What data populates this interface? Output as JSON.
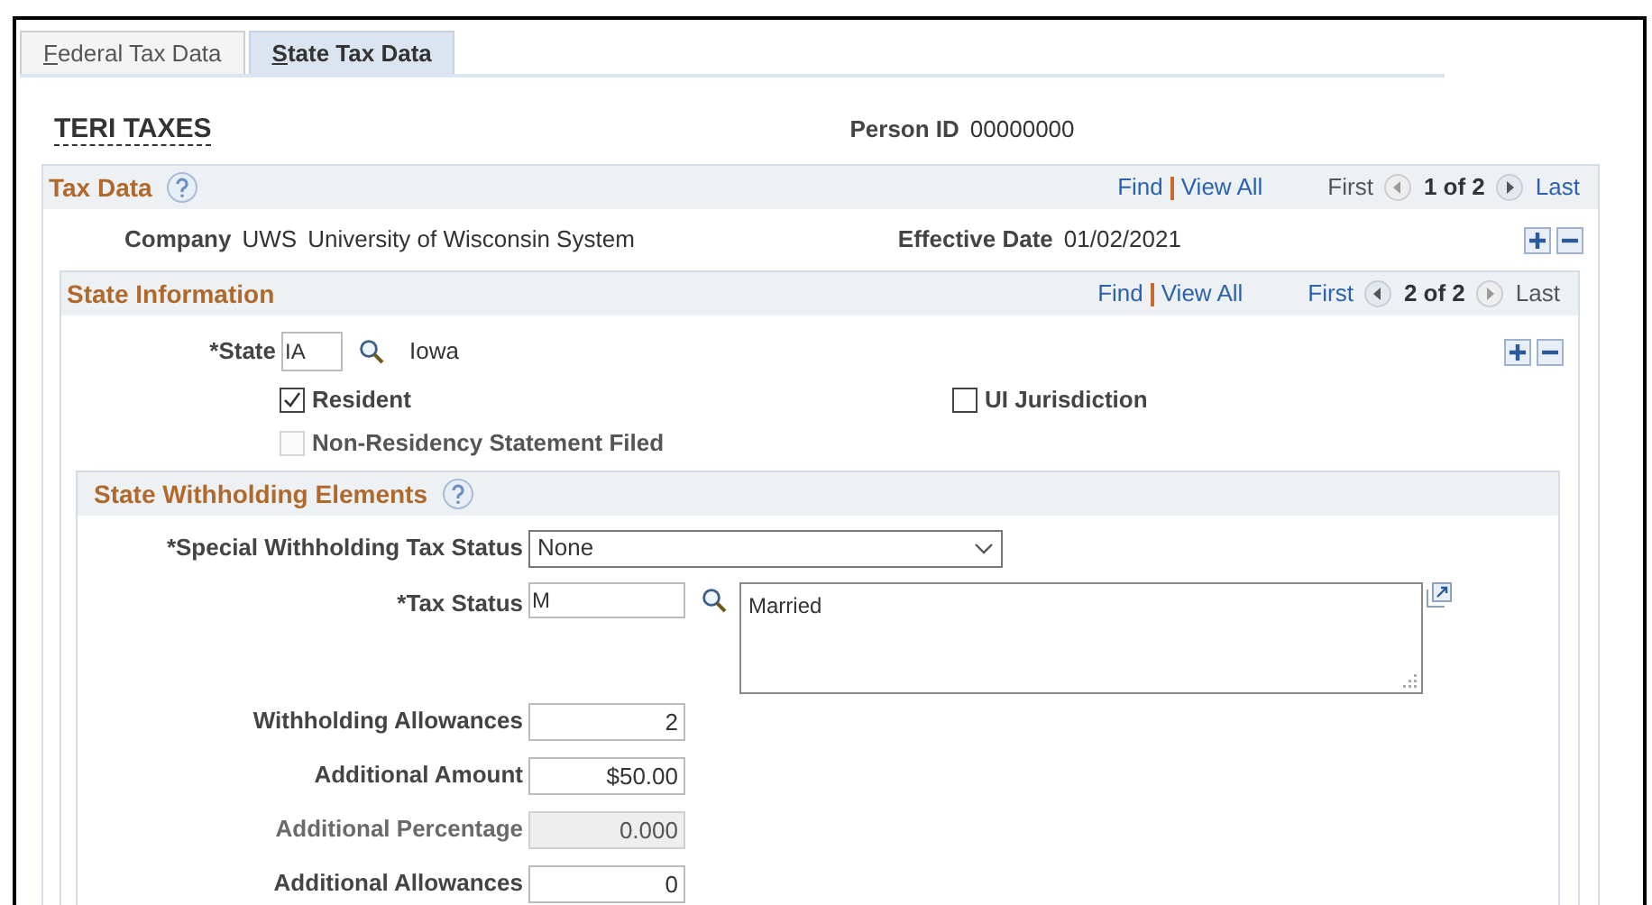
{
  "tabs": [
    {
      "label": "Federal Tax Data",
      "selected": false
    },
    {
      "label": "State Tax Data",
      "selected": true
    }
  ],
  "employee_name": "TERI TAXES",
  "person_id": {
    "label": "Person ID",
    "value": "00000000"
  },
  "tax_data": {
    "title": "Tax Data",
    "nav": {
      "find": "Find",
      "view_all": "View All",
      "first": {
        "label": "First",
        "disabled": true
      },
      "position": "1 of 2",
      "last": {
        "label": "Last",
        "disabled": false
      }
    },
    "company": {
      "label": "Company",
      "code": "UWS",
      "name": "University of Wisconsin System"
    },
    "effective_date": {
      "label": "Effective Date",
      "value": "01/02/2021"
    }
  },
  "state_information": {
    "title": "State Information",
    "nav": {
      "find": "Find",
      "view_all": "View All",
      "first": {
        "label": "First",
        "disabled": false
      },
      "position": "2 of 2",
      "last": {
        "label": "Last",
        "disabled": true
      }
    },
    "state": {
      "label": "*State",
      "value": "IA",
      "description": "Iowa"
    },
    "checkboxes": [
      {
        "label": "Resident",
        "checked": true,
        "disabled": false
      },
      {
        "label": "UI Jurisdiction",
        "checked": false,
        "disabled": false
      },
      {
        "label": "Non-Residency Statement Filed",
        "checked": false,
        "disabled": true
      }
    ]
  },
  "withholding": {
    "title": "State Withholding Elements",
    "special_status": {
      "label": "*Special Withholding Tax Status",
      "value": "None"
    },
    "tax_status": {
      "label": "*Tax Status",
      "value": "M",
      "description": "Married"
    },
    "fields": [
      {
        "label": "Withholding Allowances",
        "value": "2",
        "disabled": false
      },
      {
        "label": "Additional Amount",
        "value": "$50.00",
        "disabled": false
      },
      {
        "label": "Additional Percentage",
        "value": "0.000",
        "disabled": true
      },
      {
        "label": "Additional Allowances",
        "value": "0",
        "disabled": false
      }
    ]
  }
}
